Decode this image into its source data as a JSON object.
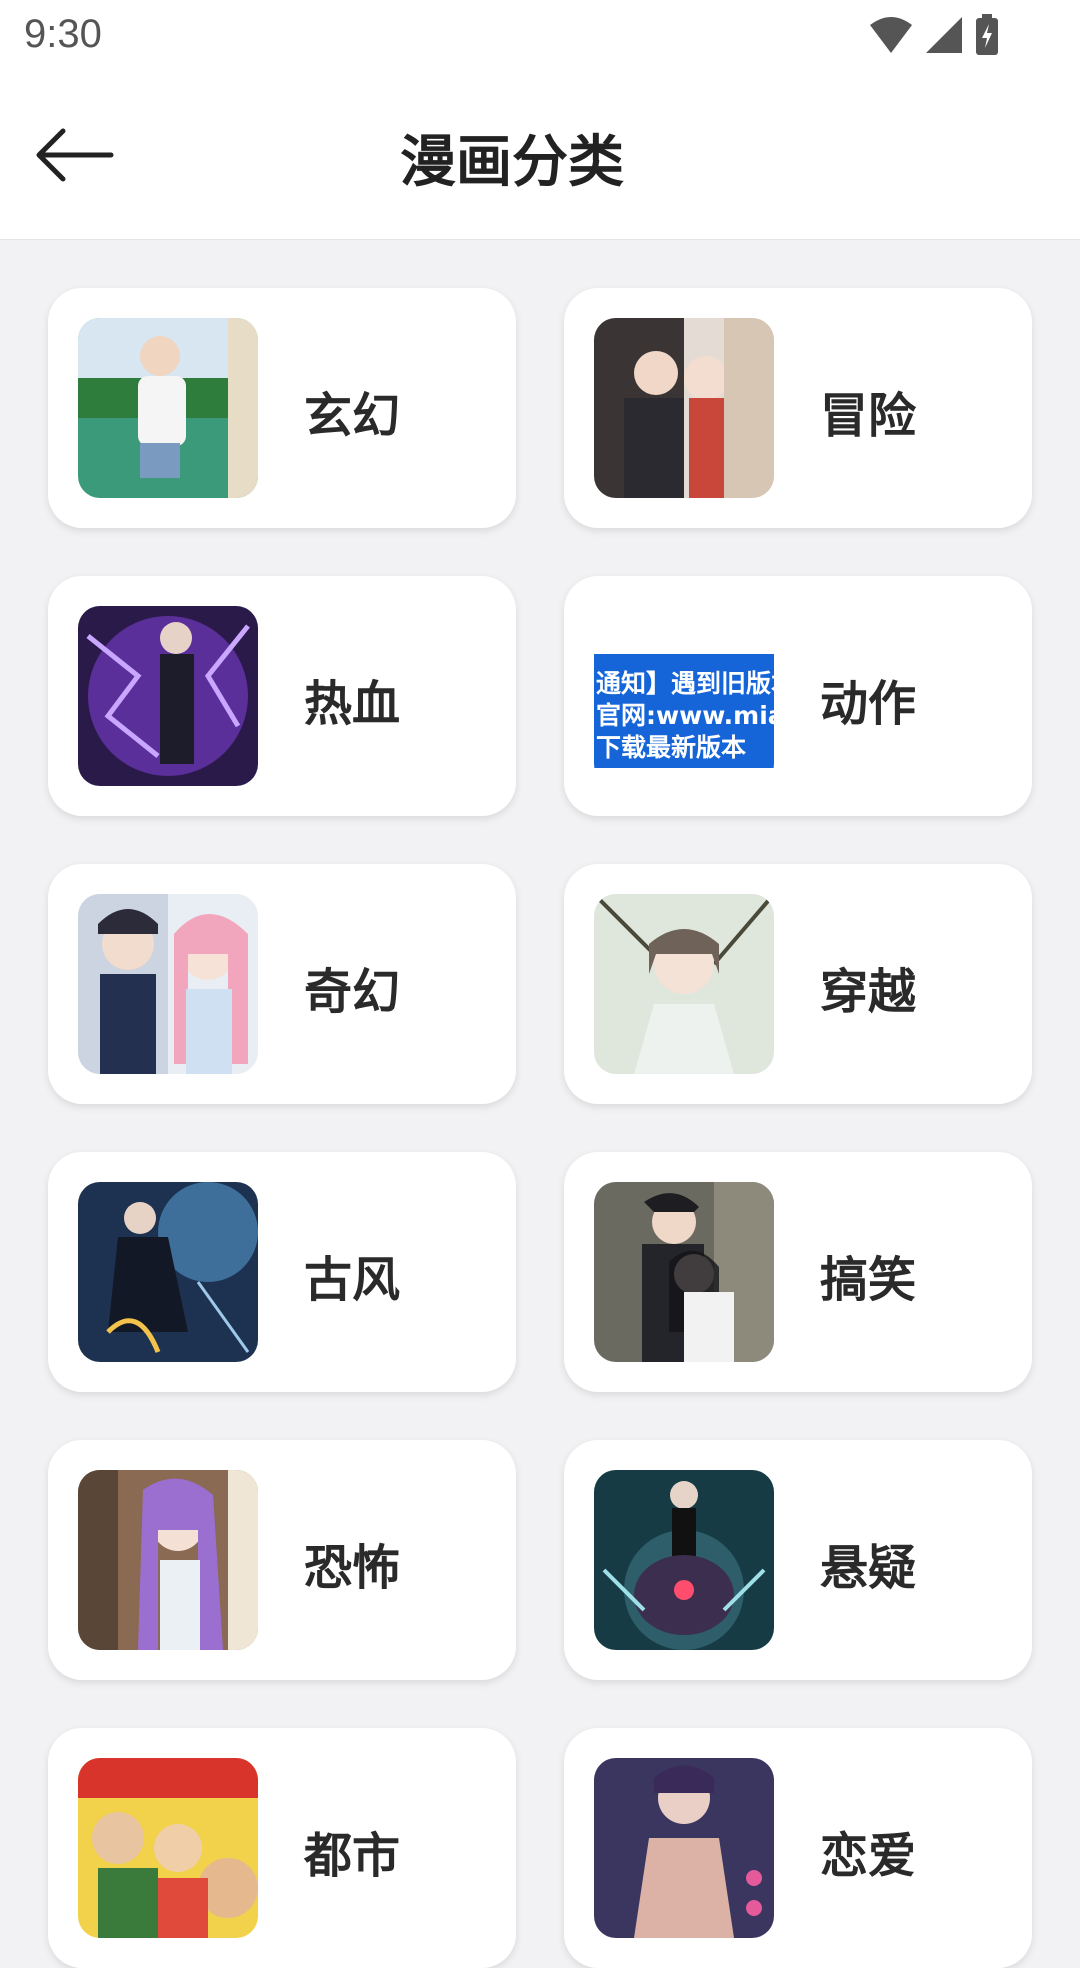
{
  "status": {
    "time": "9:30",
    "icons": [
      "wifi-icon",
      "signal-icon",
      "battery-charging-icon"
    ]
  },
  "appbar": {
    "title": "漫画分类",
    "back_icon": "arrow-left-icon"
  },
  "categories": [
    {
      "label": "玄幻",
      "thumb": "cover-image"
    },
    {
      "label": "冒险",
      "thumb": "cover-image"
    },
    {
      "label": "热血",
      "thumb": "cover-image"
    },
    {
      "label": "动作",
      "thumb": "notice-banner-image",
      "thumb_text": [
        "通知】遇到旧版本",
        "官网:www.miao",
        "下载最新版本"
      ]
    },
    {
      "label": "奇幻",
      "thumb": "cover-image"
    },
    {
      "label": "穿越",
      "thumb": "cover-image"
    },
    {
      "label": "古风",
      "thumb": "cover-image"
    },
    {
      "label": "搞笑",
      "thumb": "cover-image"
    },
    {
      "label": "恐怖",
      "thumb": "cover-image"
    },
    {
      "label": "悬疑",
      "thumb": "cover-image"
    },
    {
      "label": "都市",
      "thumb": "cover-image"
    },
    {
      "label": "恋爱",
      "thumb": "cover-image"
    }
  ],
  "colors": {
    "background": "#f2f2f4",
    "card": "#ffffff",
    "text": "#222222",
    "notice_blue": "#1565d8"
  }
}
